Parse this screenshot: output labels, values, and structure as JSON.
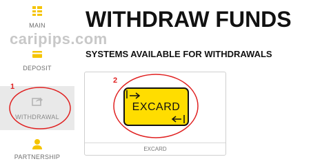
{
  "watermark": "caripips.com",
  "sidebar": {
    "items": [
      {
        "label": "MAIN",
        "icon": "dashboard-icon"
      },
      {
        "label": "DEPOSIT",
        "icon": "credit-card-icon"
      },
      {
        "label": "WITHDRAWAL",
        "icon": "share-export-icon",
        "active": true
      },
      {
        "label": "PARTNERSHIP",
        "icon": "user-icon"
      }
    ]
  },
  "annotations": [
    "1",
    "2"
  ],
  "main": {
    "title": "WITHDRAW FUNDS",
    "subtitle": "SYSTEMS AVAILABLE FOR WITHDRAWALS",
    "systems": [
      {
        "logo_text": "EXCARD",
        "name": "EXCARD",
        "logo_color": "#ffdd00"
      }
    ]
  },
  "colors": {
    "accent_yellow": "#ffcc00",
    "annotation_red": "#e02020",
    "active_bg": "#e9e9e9"
  }
}
